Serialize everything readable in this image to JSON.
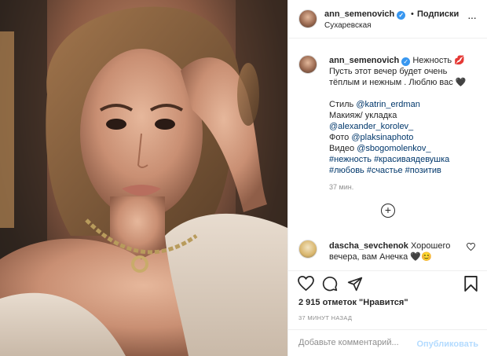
{
  "post": {
    "image_alt": "Portrait photo",
    "icons": {
      "more": "more-horizontal-icon",
      "like": "heart-icon",
      "comment": "comment-icon",
      "share": "paper-plane-icon",
      "save": "bookmark-icon",
      "add_comment": "plus-circle-icon"
    }
  },
  "header": {
    "username": "ann_semenovich",
    "dot": "•",
    "follow_label": "Подписки",
    "location": "Сухаревская",
    "more": "···"
  },
  "caption": {
    "username": "ann_semenovich",
    "title_text": "Нежность 💋",
    "line1": "Пусть этот вечер будет очень тёплым и нежным . Люблю вас 🖤",
    "style_label": "Стиль",
    "style_link": "@katrin_erdman",
    "makeup_label": "Макияж/ укладка",
    "makeup_link": "@alexander_korolev_",
    "photo_label": "Фото",
    "photo_link": "@plaksinaphoto",
    "video_label": "Видео",
    "video_link": "@sbogomolenkov_",
    "tags1": "#нежность #красиваядевушка",
    "tags2": "#любовь #счастье #позитив",
    "time": "37 мин."
  },
  "comment": {
    "username": "dascha_sevchenok",
    "text": "Хорошего вечера, вам Анечка 🖤😊"
  },
  "likes": "2 915 отметок \"Нравится\"",
  "post_time": "37 МИНУТ НАЗАД",
  "add_comment": {
    "placeholder": "Добавьте комментарий...",
    "publish_label": "Опубликовать"
  }
}
